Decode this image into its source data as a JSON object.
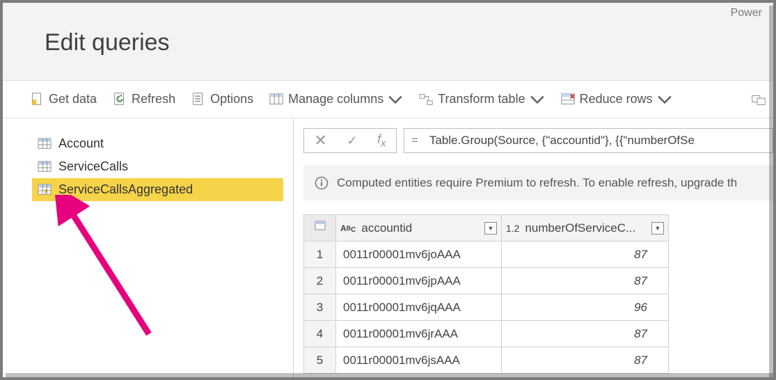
{
  "app_label": "Power",
  "page_title": "Edit queries",
  "toolbar": {
    "get_data": "Get data",
    "refresh": "Refresh",
    "options": "Options",
    "manage_columns": "Manage columns",
    "transform_table": "Transform table",
    "reduce_rows": "Reduce rows"
  },
  "sidebar": {
    "queries": [
      {
        "name": "Account",
        "computed": false,
        "selected": false
      },
      {
        "name": "ServiceCalls",
        "computed": false,
        "selected": false
      },
      {
        "name": "ServiceCallsAggregated",
        "computed": true,
        "selected": true
      }
    ]
  },
  "formula_bar": {
    "text": "Table.Group(Source, {\"accountid\"}, {{\"numberOfSe"
  },
  "notice": "Computed entities require Premium to refresh. To enable refresh, upgrade th",
  "table": {
    "columns": [
      {
        "name": "accountid",
        "type_icon": "ABC"
      },
      {
        "name": "numberOfServiceC...",
        "type_icon": "1.2"
      }
    ],
    "rows": [
      [
        "0011r00001mv6joAAA",
        87
      ],
      [
        "0011r00001mv6jpAAA",
        87
      ],
      [
        "0011r00001mv6jqAAA",
        96
      ],
      [
        "0011r00001mv6jrAAA",
        87
      ],
      [
        "0011r00001mv6jsAAA",
        87
      ]
    ]
  }
}
